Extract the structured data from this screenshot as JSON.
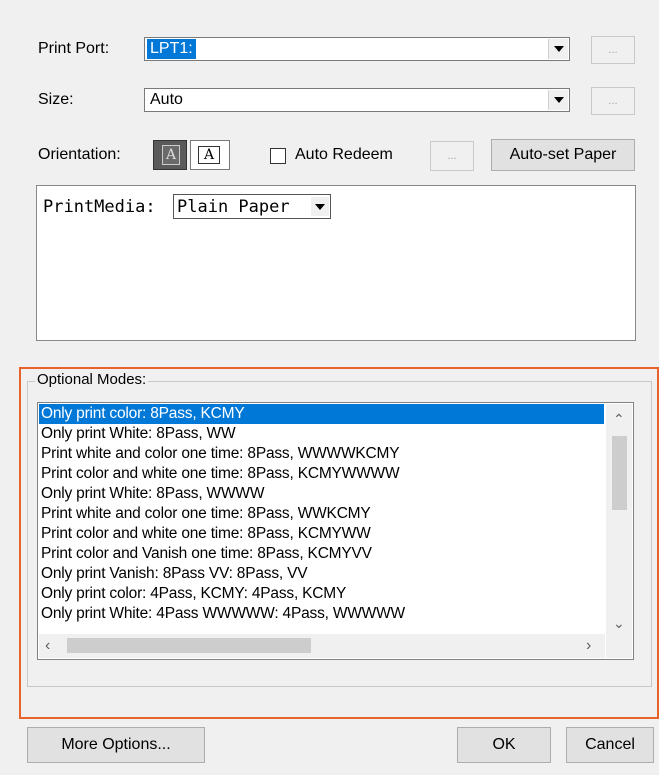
{
  "print_port": {
    "label": "Print Port:",
    "value": "LPT1:"
  },
  "size": {
    "label": "Size:",
    "value": "Auto"
  },
  "orientation": {
    "label": "Orientation:",
    "portrait_glyph": "A",
    "landscape_glyph": "A"
  },
  "auto_redeem": {
    "label": "Auto Redeem",
    "checked": false
  },
  "ellipsis": "...",
  "auto_set_paper": "Auto-set Paper",
  "print_media": {
    "label": "PrintMedia:",
    "value": "Plain Paper"
  },
  "optional_modes": {
    "title": "Optional Modes:",
    "items": [
      "Only print color: 8Pass, KCMY",
      "Only print White: 8Pass, WW",
      "Print white and color one time: 8Pass, WWWWKCMY",
      "Print color and white one time: 8Pass, KCMYWWWW",
      "Only print White: 8Pass, WWWW",
      "Print white and color one time: 8Pass, WWKCMY",
      "Print color and white one time: 8Pass, KCMYWW",
      "Print color and Vanish one time: 8Pass, KCMYVV",
      "Only print Vanish: 8Pass VV: 8Pass, VV",
      "Only print color: 4Pass, KCMY: 4Pass, KCMY",
      "Only print White: 4Pass WWWWW: 4Pass, WWWWW"
    ],
    "selected_index": 0
  },
  "buttons": {
    "more_options": "More Options...",
    "ok": "OK",
    "cancel": "Cancel"
  },
  "colors": {
    "selection": "#0078d7",
    "highlight_border": "#e8632b"
  }
}
